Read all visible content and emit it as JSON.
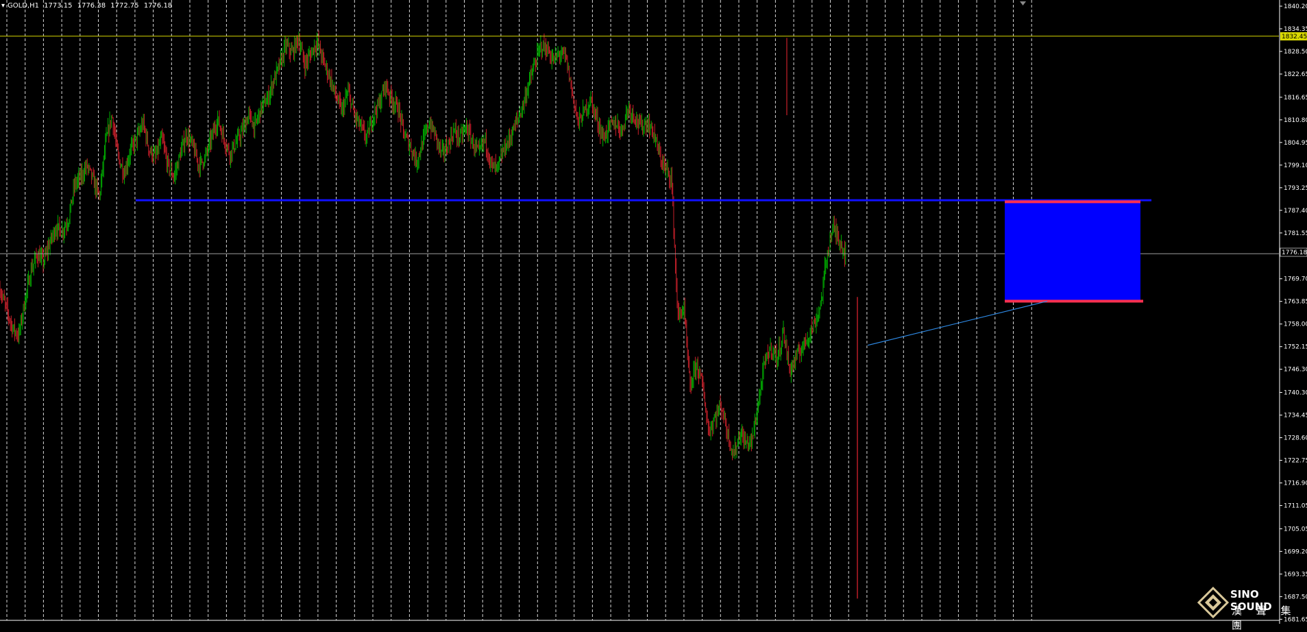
{
  "header": {
    "symbol": "GOLD,H1",
    "open": "1773.15",
    "high": "1776.38",
    "low": "1772.75",
    "close": "1776.18"
  },
  "price_axis": {
    "labels": [
      "1840.20",
      "1834.35",
      "1828.50",
      "1822.65",
      "1816.65",
      "1810.80",
      "1804.95",
      "1799.10",
      "1793.25",
      "1787.40",
      "1781.55",
      "1769.70",
      "1763.85",
      "1758.00",
      "1752.15",
      "1746.30",
      "1740.30",
      "1734.45",
      "1728.60",
      "1722.75",
      "1716.90",
      "1711.05",
      "1705.05",
      "1699.20",
      "1693.35",
      "1687.50",
      "1681.65"
    ],
    "current_price_label": "1776.18",
    "marked_level_label": "1832.45"
  },
  "colors": {
    "background": "#000000",
    "up_candle": "#00b000",
    "down_candle": "#c8202a",
    "grid": "#ffffff",
    "resistance_line": "#d8d800",
    "support_line": "#1010ff",
    "zone_fill": "#0000ff",
    "zone_border": "#ff3050",
    "trendline": "#2e8ae6",
    "current_price_line": "#a0a0a0"
  },
  "logo": {
    "line1": "SINO SOUND",
    "line2": "漢 聲 集 團",
    "icon": "diamond-logo-icon"
  },
  "chart_data": {
    "type": "candlestick",
    "symbol": "GOLD",
    "timeframe": "H1",
    "ylim": [
      1681.65,
      1843.0
    ],
    "grid": "vertical dashed",
    "horizontal_levels": [
      {
        "name": "resistance",
        "value": 1832.45,
        "style": "solid"
      },
      {
        "name": "support",
        "value": 1790.0,
        "style": "thick"
      },
      {
        "name": "current",
        "value": 1776.18,
        "style": "thin"
      }
    ],
    "zone": {
      "top": 1789.6,
      "bottom": 1763.9
    },
    "trendline": {
      "start": 1752.5,
      "end": 1763.9
    },
    "close_path": [
      1767,
      1762,
      1757,
      1755,
      1764,
      1772,
      1776,
      1774,
      1779,
      1783,
      1782,
      1785,
      1794,
      1796,
      1799,
      1795,
      1791,
      1805,
      1812,
      1801,
      1797,
      1803,
      1806,
      1810,
      1803,
      1801,
      1806,
      1799,
      1796,
      1802,
      1807,
      1804,
      1799,
      1801,
      1806,
      1811,
      1806,
      1802,
      1805,
      1808,
      1812,
      1809,
      1814,
      1816,
      1821,
      1825,
      1830,
      1828,
      1832,
      1825,
      1828,
      1831,
      1826,
      1822,
      1817,
      1813,
      1818,
      1812,
      1809,
      1806,
      1812,
      1815,
      1820,
      1816,
      1814,
      1807,
      1804,
      1800,
      1805,
      1810,
      1807,
      1802,
      1804,
      1808,
      1806,
      1809,
      1805,
      1802,
      1806,
      1799,
      1798,
      1803,
      1806,
      1810,
      1814,
      1820,
      1825,
      1830,
      1829,
      1826,
      1828,
      1827,
      1818,
      1810,
      1813,
      1816,
      1811,
      1806,
      1809,
      1810,
      1808,
      1814,
      1812,
      1809,
      1810,
      1808,
      1802,
      1798,
      1796,
      1760,
      1762,
      1741,
      1748,
      1742,
      1730,
      1734,
      1737,
      1730,
      1724,
      1730,
      1727,
      1728,
      1738,
      1748,
      1752,
      1749,
      1756,
      1746,
      1749,
      1752,
      1755,
      1758,
      1763,
      1776,
      1783,
      1780,
      1776
    ]
  }
}
